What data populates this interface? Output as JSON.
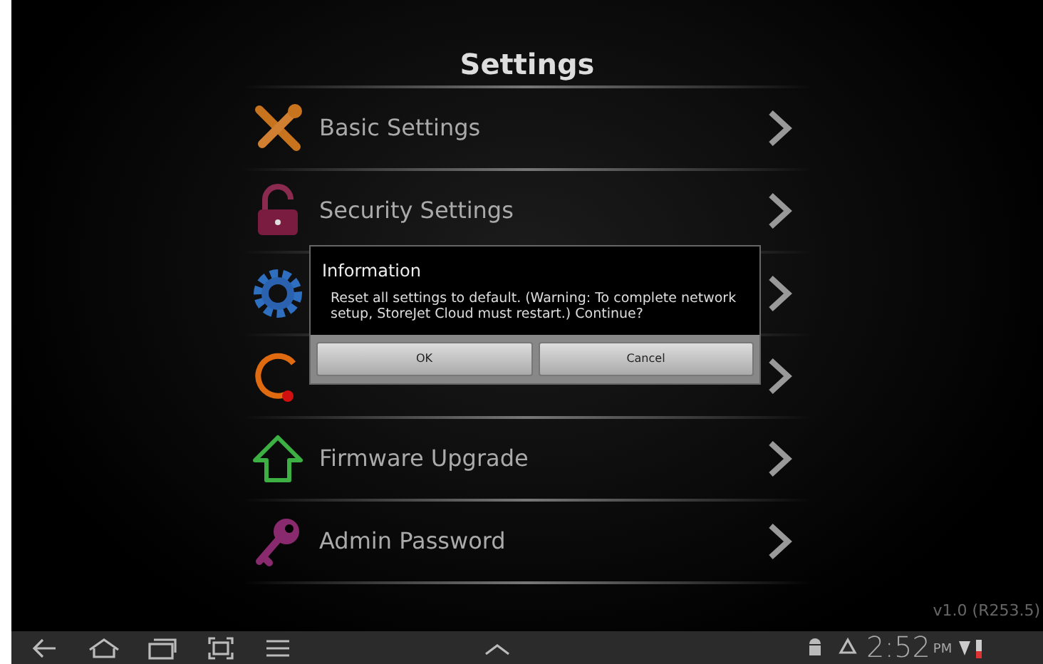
{
  "title": "Settings",
  "items": [
    {
      "kind": "tools",
      "label": "Basic Settings"
    },
    {
      "kind": "lock",
      "label": "Security Settings"
    },
    {
      "kind": "gear"
    },
    {
      "kind": "reset"
    },
    {
      "kind": "upload",
      "label": "Firmware Upgrade"
    },
    {
      "kind": "key",
      "label": "Admin Password"
    }
  ],
  "version": "v1.0 (R253.5)",
  "dialog": {
    "title": "Information",
    "message": "Reset all settings to default. (Warning: To complete network setup, StoreJet Cloud must restart.) Continue?",
    "buttons": [
      "OK",
      "Cancel"
    ]
  },
  "system_bar": {
    "time": "2:52",
    "ampm": "PM"
  }
}
